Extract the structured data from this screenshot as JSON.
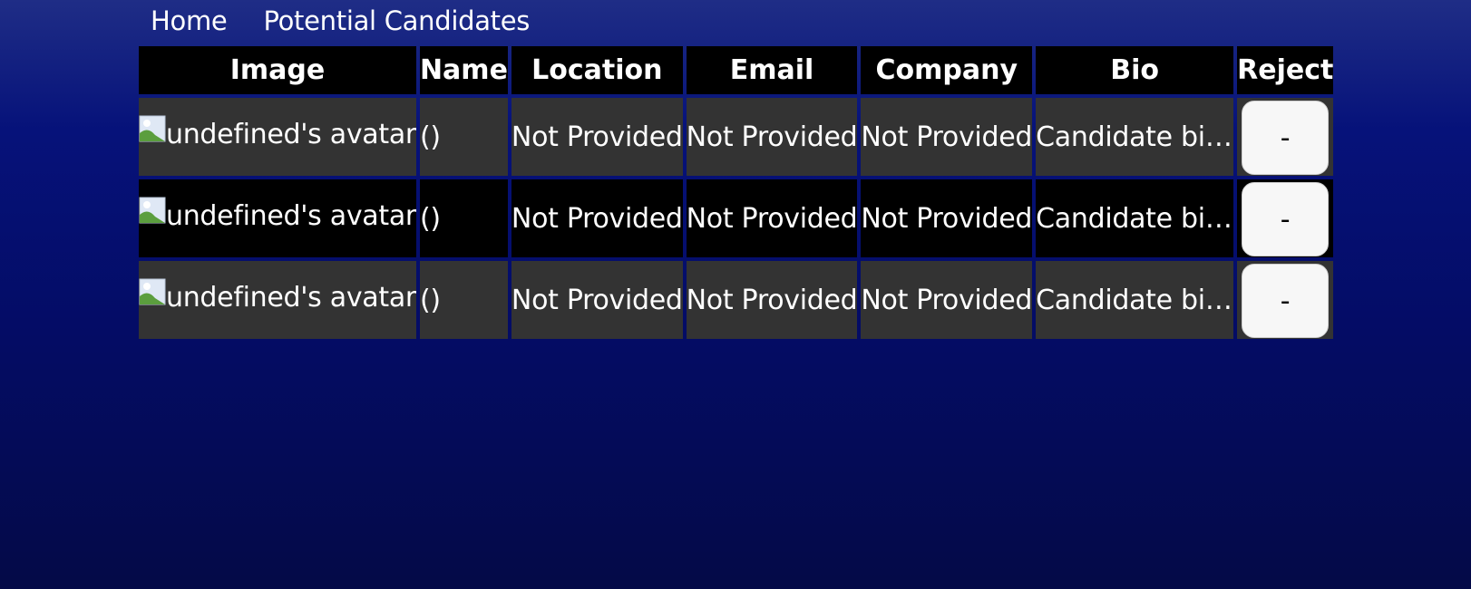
{
  "nav": {
    "home_label": "Home",
    "candidates_label": "Potential Candidates"
  },
  "table": {
    "headers": {
      "image": "Image",
      "name": "Name",
      "location": "Location",
      "email": "Email",
      "company": "Company",
      "bio": "Bio",
      "reject": "Reject"
    },
    "rows": [
      {
        "avatar_alt": "undefined's avatar",
        "name": "()",
        "location": "Not Provided",
        "email": "Not Provided",
        "company": "Not Provided",
        "bio": "Candidate bio...",
        "reject_label": "-"
      },
      {
        "avatar_alt": "undefined's avatar",
        "name": "()",
        "location": "Not Provided",
        "email": "Not Provided",
        "company": "Not Provided",
        "bio": "Candidate bio...",
        "reject_label": "-"
      },
      {
        "avatar_alt": "undefined's avatar",
        "name": "()",
        "location": "Not Provided",
        "email": "Not Provided",
        "company": "Not Provided",
        "bio": "Candidate bio...",
        "reject_label": "-"
      }
    ]
  },
  "colors": {
    "background_top": "#1f2d86",
    "background_bottom": "#040a47",
    "header_bg": "#000000",
    "row_light_bg": "#333333",
    "row_dark_bg": "#000000",
    "button_bg": "#f7f7f7"
  },
  "icons": {
    "broken_image": "broken-image-icon"
  }
}
